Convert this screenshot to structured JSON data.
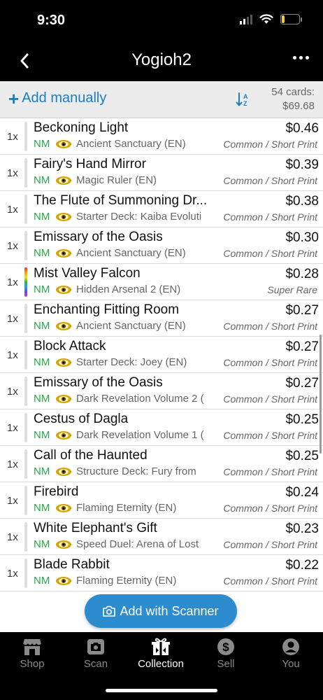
{
  "status": {
    "time": "9:30",
    "battery": "17"
  },
  "nav": {
    "title": "Yogioh2"
  },
  "toolbar": {
    "add_label": "Add manually",
    "cards_count": "54 cards:",
    "cards_total": "$69.68"
  },
  "cards": [
    {
      "qty": "1x",
      "name": "Beckoning Light",
      "price": "$0.46",
      "condition": "NM",
      "set": "Ancient Sanctuary (EN)",
      "rarity": "Common / Short Print",
      "rainbow": false
    },
    {
      "qty": "1x",
      "name": "Fairy's Hand Mirror",
      "price": "$0.39",
      "condition": "NM",
      "set": "Magic Ruler (EN)",
      "rarity": "Common / Short Print",
      "rainbow": false
    },
    {
      "qty": "1x",
      "name": "The Flute of Summoning Dr...",
      "price": "$0.38",
      "condition": "NM",
      "set": "Starter Deck: Kaiba Evoluti",
      "rarity": "Common / Short Print",
      "rainbow": false
    },
    {
      "qty": "1x",
      "name": "Emissary of the Oasis",
      "price": "$0.30",
      "condition": "NM",
      "set": "Ancient Sanctuary (EN)",
      "rarity": "Common / Short Print",
      "rainbow": false
    },
    {
      "qty": "1x",
      "name": "Mist Valley Falcon",
      "price": "$0.28",
      "condition": "NM",
      "set": "Hidden Arsenal 2 (EN)",
      "rarity": "Super Rare",
      "rainbow": true
    },
    {
      "qty": "1x",
      "name": "Enchanting Fitting Room",
      "price": "$0.27",
      "condition": "NM",
      "set": "Ancient Sanctuary (EN)",
      "rarity": "Common / Short Print",
      "rainbow": false
    },
    {
      "qty": "1x",
      "name": "Block Attack",
      "price": "$0.27",
      "condition": "NM",
      "set": "Starter Deck: Joey (EN)",
      "rarity": "Common / Short Print",
      "rainbow": false
    },
    {
      "qty": "1x",
      "name": "Emissary of the Oasis",
      "price": "$0.27",
      "condition": "NM",
      "set": "Dark Revelation Volume 2 (",
      "rarity": "Common / Short Print",
      "rainbow": false
    },
    {
      "qty": "1x",
      "name": "Cestus of Dagla",
      "price": "$0.25",
      "condition": "NM",
      "set": "Dark Revelation Volume 1 (",
      "rarity": "Common / Short Print",
      "rainbow": false
    },
    {
      "qty": "1x",
      "name": "Call of the Haunted",
      "price": "$0.25",
      "condition": "NM",
      "set": "Structure Deck: Fury from",
      "rarity": "Common / Short Print",
      "rainbow": false
    },
    {
      "qty": "1x",
      "name": "Firebird",
      "price": "$0.24",
      "condition": "NM",
      "set": "Flaming Eternity (EN)",
      "rarity": "Common / Short Print",
      "rainbow": false
    },
    {
      "qty": "1x",
      "name": "White Elephant's Gift",
      "price": "$0.23",
      "condition": "NM",
      "set": "Speed Duel: Arena of Lost",
      "rarity": "Common / Short Print",
      "rainbow": false
    },
    {
      "qty": "1x",
      "name": "Blade Rabbit",
      "price": "$0.22",
      "condition": "NM",
      "set": "Flaming Eternity (EN)",
      "rarity": "Common / Short Print",
      "rainbow": false
    }
  ],
  "scanner": {
    "label": "Add with Scanner"
  },
  "tabs": [
    {
      "label": "Shop",
      "icon": "shop-icon",
      "active": false
    },
    {
      "label": "Scan",
      "icon": "camera-icon",
      "active": false
    },
    {
      "label": "Collection",
      "icon": "collection-icon",
      "active": true
    },
    {
      "label": "Sell",
      "icon": "dollar-icon",
      "active": false
    },
    {
      "label": "You",
      "icon": "user-icon",
      "active": false
    }
  ],
  "colors": {
    "accent": "#1a7fc1",
    "condition_green": "#2aa84a",
    "scanner_button": "#2d8ccd"
  }
}
